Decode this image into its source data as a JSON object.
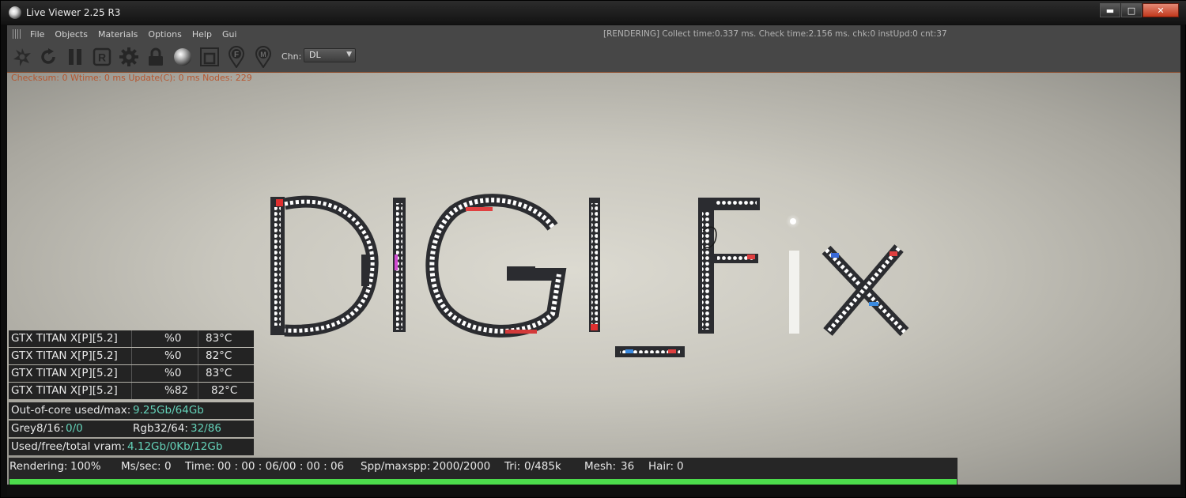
{
  "window": {
    "title": "Live Viewer 2.25 R3",
    "minimize_glyph": "▬",
    "maximize_glyph": "□",
    "close_glyph": "✕"
  },
  "menu": {
    "items": [
      "File",
      "Objects",
      "Materials",
      "Options",
      "Help",
      "Gui"
    ],
    "status": "[RENDERING] Collect time:0.337 ms.  Check time:2.156 ms.  chk:0  instUpd:0  cnt:37"
  },
  "toolbar": {
    "icons": [
      "lightning-icon",
      "refresh-icon",
      "pause-icon",
      "region-render-icon",
      "settings-gear-icon",
      "lock-icon",
      "material-sphere-icon",
      "crop-icon",
      "focus-pin-icon",
      "material-pin-icon"
    ],
    "region_letter": "R",
    "focus_letter": "F",
    "material_letter": "M",
    "channel_label": "Chn:",
    "channel_value": "DL"
  },
  "viewport": {
    "overlay_info": "Checksum: 0 Wtime: 0 ms  Update(C): 0 ms  Nodes: 229",
    "gpus": [
      {
        "name": "GTX TITAN X[P][5.2]",
        "usage": "%0",
        "temp": "83°C"
      },
      {
        "name": "GTX TITAN X[P][5.2]",
        "usage": "%0",
        "temp": "82°C"
      },
      {
        "name": "GTX TITAN X[P][5.2]",
        "usage": "%0",
        "temp": "83°C"
      },
      {
        "name": "GTX TITAN X[P][5.2]",
        "usage": "%82",
        "temp": "82°C"
      }
    ],
    "out_of_core": {
      "label": "Out-of-core used/max:",
      "value": "9.25Gb/64Gb"
    },
    "grey": {
      "label": "Grey8/16:",
      "value": "0/0"
    },
    "rgb": {
      "label": "Rgb32/64:",
      "value": "32/86"
    },
    "vram": {
      "label": "Used/free/total vram:",
      "value": "4.12Gb/0Kb/12Gb"
    }
  },
  "status_bar": {
    "rendering": {
      "label": "Rendering:",
      "value": "100%"
    },
    "ms_sec": {
      "label": "Ms/sec:",
      "value": "0"
    },
    "time": {
      "label": "Time:",
      "value": "00 : 00 : 06/00 : 00 : 06"
    },
    "spp": {
      "label": "Spp/maxspp:",
      "value": "2000/2000"
    },
    "tri": {
      "label": "Tri:",
      "value": "0/485k"
    },
    "mesh": {
      "label": "Mesh:",
      "value": "36"
    },
    "hair": {
      "label": "Hair:",
      "value": "0"
    },
    "progress_fraction": 1.0
  },
  "colors": {
    "accent_value": "#64d2b9",
    "progress": "#4cdc4c",
    "overlay_info": "#b94a1e"
  }
}
